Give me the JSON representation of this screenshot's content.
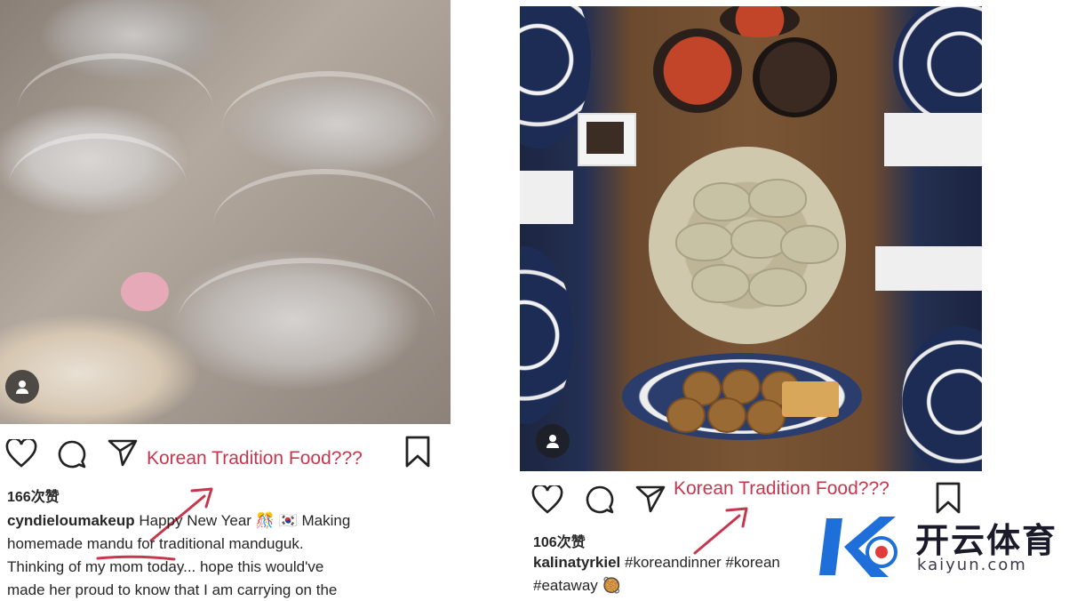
{
  "left_post": {
    "likes": "166次赞",
    "annotation": "Korean Tradition Food???",
    "username": "cyndieloumakeup",
    "caption_line1": " Happy New Year 🎊 🇰🇷 Making",
    "caption_line2a": "homemade ",
    "caption_keyword": "mandu",
    "caption_line2b": " for traditional manduguk.",
    "caption_line3": "Thinking of my mom today... hope this would've",
    "caption_line4": "made her proud to know that I am carrying on the"
  },
  "right_post": {
    "likes": "106次赞",
    "annotation": "Korean Tradition Food???",
    "username": "kalinatyrkiel",
    "caption_line1": " #koreandinner #korean",
    "caption_line2": "#eataway 🥘"
  },
  "watermark": {
    "brand_cn": "开云体育",
    "brand_en": "kaiyun.com"
  },
  "colors": {
    "annotation_red": "#c8364e",
    "watermark_blue": "#1e6fd9",
    "watermark_red": "#e23b3b"
  },
  "icons": [
    "heart-icon",
    "comment-icon",
    "share-icon",
    "bookmark-icon",
    "user-icon",
    "arrow-annotation",
    "brand-logo"
  ]
}
